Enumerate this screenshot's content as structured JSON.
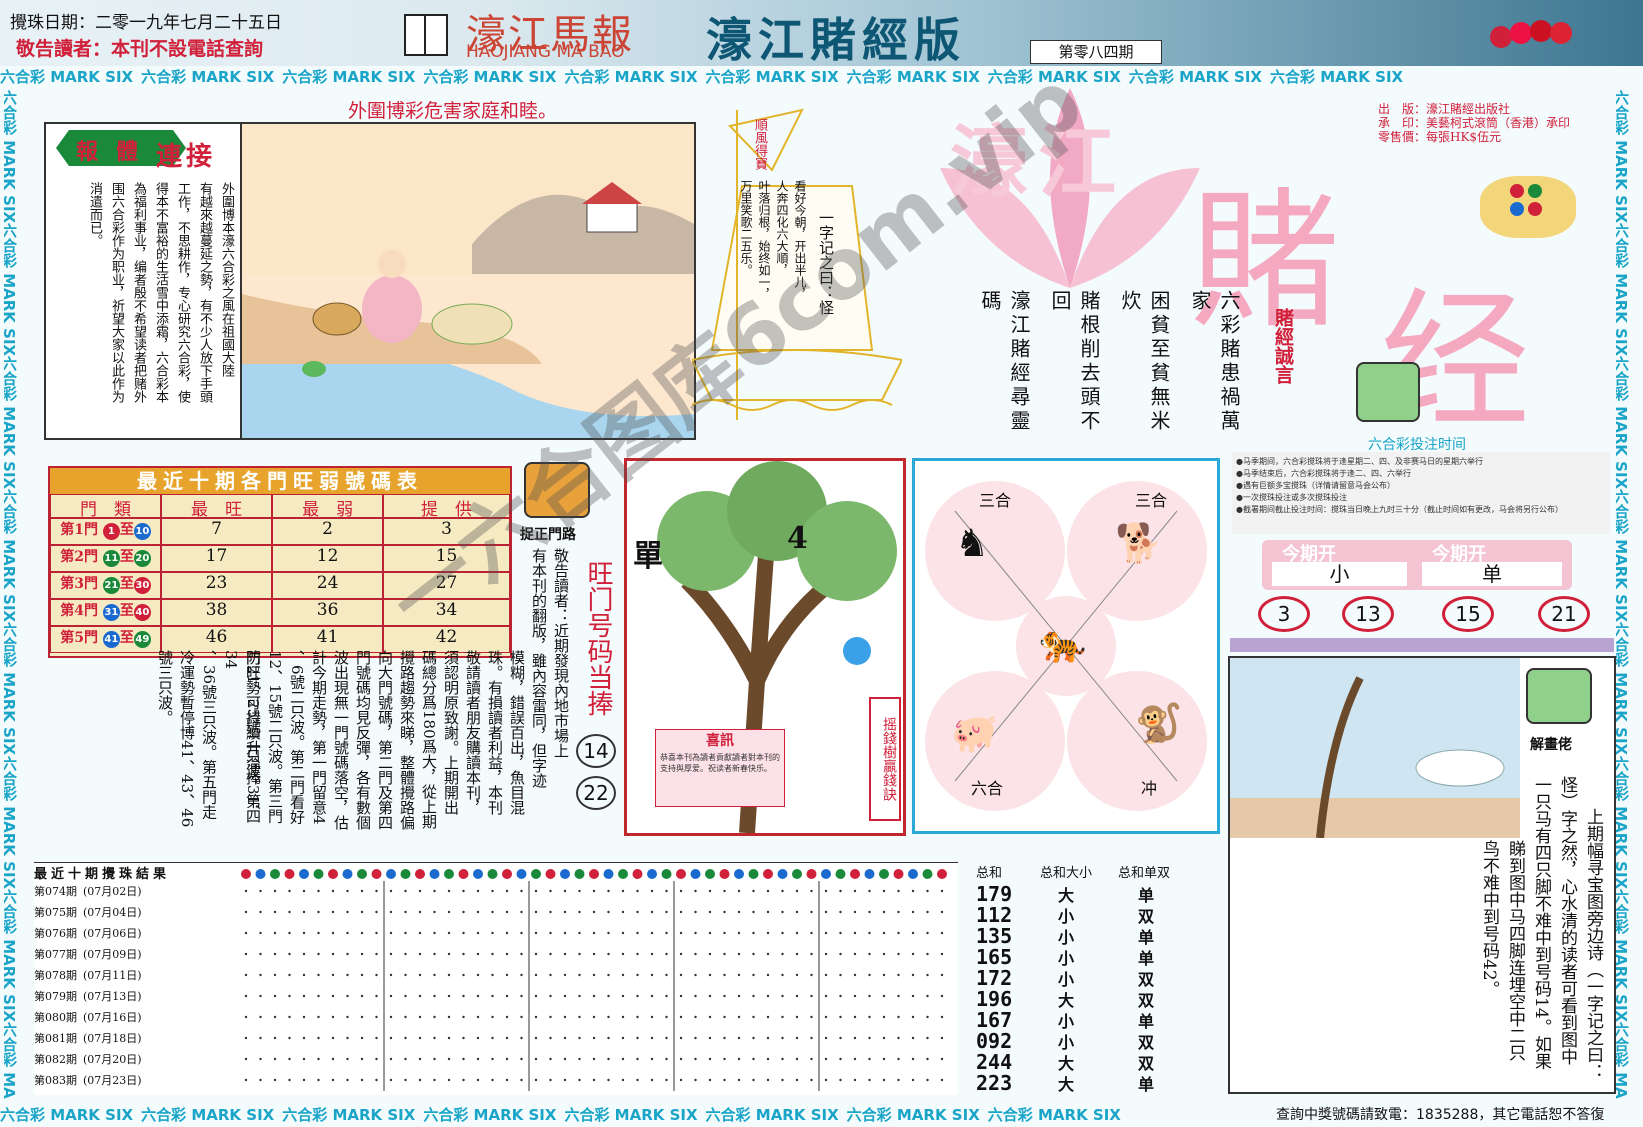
{
  "header": {
    "date_label": "攪珠日期：二零一九年七月二十五日",
    "notice": "敬告讀者：本刊不設電話查詢",
    "brand_cn": "濠江馬報",
    "brand_en": "HAOJIANG MA BAO",
    "edition": "濠江賭經版",
    "issue": "第零八四期"
  },
  "marquee": {
    "text": "六合彩 MARK SIX"
  },
  "banner_caption": "外圍博彩危害家庭和睦。",
  "serial": {
    "badge_left": "報",
    "badge_mid": "體",
    "badge_right": "連接",
    "col1": "外圍博本濠六合彩之風在祖國大陸",
    "col2": "有越來越蔓延之勢，有不少人放下手頭",
    "col3": "工作，不思耕作，专心研究六合彩，使",
    "col4": "得本不富裕的生活雪中添霜，六合彩本",
    "col5": "為福利事业，编者殷不希望读者把赌外",
    "col6": "围六合彩作为职业，祈望大家以此作为",
    "col7": "消遣而已。"
  },
  "sail": {
    "flag": "順風得寶",
    "text1": "一字记之曰：怪",
    "poem1": "看好今朝，开出半儿，",
    "poem2": "人奔四化六大順，",
    "poem3": "叶落归根，始终如一，",
    "poem4": "万里笑歌二五乐。"
  },
  "proverbs": {
    "p1": "六彩賭患禍萬家",
    "p2": "困貧至貧無米炊",
    "p3": "賭根削去頭不回",
    "p4": "濠江賭經尋靈碼",
    "heading": "賭經誠言"
  },
  "title_art": {
    "line1": "濠江",
    "line2": "賭",
    "line3": "经"
  },
  "publisher": {
    "publisher": "出　版：濠江賭經出版社",
    "printer": "承　印：美藝柯式滾筒（香港）承印",
    "price": "零售價：每張HK$伍元"
  },
  "bet_time": {
    "title": "六合彩投注时间",
    "lines": [
      "●马季期间，六合彩搅珠将于逢星期二、四、及非赛马日的星期六举行",
      "●马季结束后，六合彩搅珠将于逢二、四、六举行",
      "●遇有巨额多宝搅珠（详情请留意马会公布）",
      "●一次搅珠投注或多次搅珠投注",
      "●截署期间截止投注时间：搅珠当日晚上九时三十分（截止时间如有更改，马会将另行公布）"
    ]
  },
  "this_period": {
    "label1": "今期开",
    "label2": "今期开",
    "val1": "小",
    "val2": "单",
    "numbers": [
      "3",
      "13",
      "15",
      "21"
    ]
  },
  "door_table": {
    "title": "最近十期各門旺弱號碼表",
    "headers": [
      "門　類",
      "最　旺",
      "最　弱",
      "提　供"
    ],
    "rows": [
      {
        "door": "第1門",
        "from": "1",
        "to": "10",
        "hot": "7",
        "weak": "2",
        "tip": "3"
      },
      {
        "door": "第2門",
        "from": "11",
        "to": "20",
        "hot": "17",
        "weak": "12",
        "tip": "15"
      },
      {
        "door": "第3門",
        "from": "21",
        "to": "30",
        "hot": "23",
        "weak": "24",
        "tip": "27"
      },
      {
        "door": "第4門",
        "from": "31",
        "to": "40",
        "hot": "38",
        "weak": "36",
        "tip": "34"
      },
      {
        "door": "第5門",
        "from": "41",
        "to": "49",
        "hot": "46",
        "weak": "41",
        "tip": "42"
      }
    ],
    "connector": "至"
  },
  "door_commentary": {
    "label": "捉正門路",
    "hot_title": "旺门号码当捧",
    "hot_numbers": [
      "14",
      "22"
    ],
    "c1": "敬告讀者：近期發現內地市場上",
    "c2": "有本刊的翻版，雖內容雷同，但字迹",
    "c3": "模糊，錯誤百出，魚目混",
    "c4": "珠。有損讀者利益，本刊",
    "c5": "敬請讀者朋友購讀本刊，",
    "c6": "須認明原致謝。上期開出",
    "c7": "碼總分爲180爲大，從上期",
    "c8": "攪路趨勢來睇，整體攪路偏",
    "c9": "向大門號碼，第二門及第四",
    "c10": "門號碼均見反彈，各有數個",
    "c11": "波出現無一門號碼落空，估",
    "c12": "計今期走勢，第一門留意4",
    "c13": "、6號二只波。第二門看好",
    "c14": "12、15號二只波。第三門",
    "c15": "防21、25號二只波。第四",
    "c16": "門旺勢可持續升溫捧31、34",
    "c17": "、36號三只波。第五門走",
    "c18": "冷運勢暫停博41、43、46",
    "c19": "號三只波。"
  },
  "tree": {
    "label_single": "單",
    "number": "4",
    "side_label": "摇錢樹贏錢訣",
    "news_title": "喜訊",
    "news_text": "恭喜本刊為讀者貢獻讀者對本刊的支持與厚爱。祝读者新春快乐。"
  },
  "zodiac": {
    "sanhe1": "三合",
    "sanhe2": "三合",
    "liuhe": "六合",
    "chong": "冲"
  },
  "explain": {
    "label": "解畫佬",
    "c1": "上期幅寻宝图旁边诗（一字记之曰：",
    "c2": "怪）字之然，心水清的读者可看到图中",
    "c3": "一只马有四只脚不难中到号码14。如果",
    "c4": "睇到图中马四脚连埋空中二只",
    "c5": "鸟不难中到号码42。"
  },
  "results": {
    "title": "最近十期攪珠結果",
    "col_sum": "总和",
    "col_size": "总和大小",
    "col_odd": "总和单双",
    "rows": [
      {
        "period": "第074期",
        "date": "(07月02日)",
        "sum": "179",
        "size": "大",
        "odd": "单"
      },
      {
        "period": "第075期",
        "date": "(07月04日)",
        "sum": "112",
        "size": "小",
        "odd": "双"
      },
      {
        "period": "第076期",
        "date": "(07月06日)",
        "sum": "135",
        "size": "小",
        "odd": "单"
      },
      {
        "period": "第077期",
        "date": "(07月09日)",
        "sum": "165",
        "size": "小",
        "odd": "单"
      },
      {
        "period": "第078期",
        "date": "(07月11日)",
        "sum": "172",
        "size": "小",
        "odd": "双"
      },
      {
        "period": "第079期",
        "date": "(07月13日)",
        "sum": "196",
        "size": "大",
        "odd": "双"
      },
      {
        "period": "第080期",
        "date": "(07月16日)",
        "sum": "167",
        "size": "小",
        "odd": "单"
      },
      {
        "period": "第081期",
        "date": "(07月18日)",
        "sum": "092",
        "size": "小",
        "odd": "双"
      },
      {
        "period": "第082期",
        "date": "(07月20日)",
        "sum": "244",
        "size": "大",
        "odd": "双"
      },
      {
        "period": "第083期",
        "date": "(07月23日)",
        "sum": "223",
        "size": "大",
        "odd": "单"
      }
    ]
  },
  "footer": {
    "hotline": "查詢中獎號碼請致電：1835288，其它電話恕不答復"
  },
  "watermark": "一六合图库6com.vip",
  "colors": {
    "red": "#d0203a",
    "cyan": "#1aa5c8",
    "pink": "#f2a9c4",
    "gold": "#e2b42a"
  }
}
